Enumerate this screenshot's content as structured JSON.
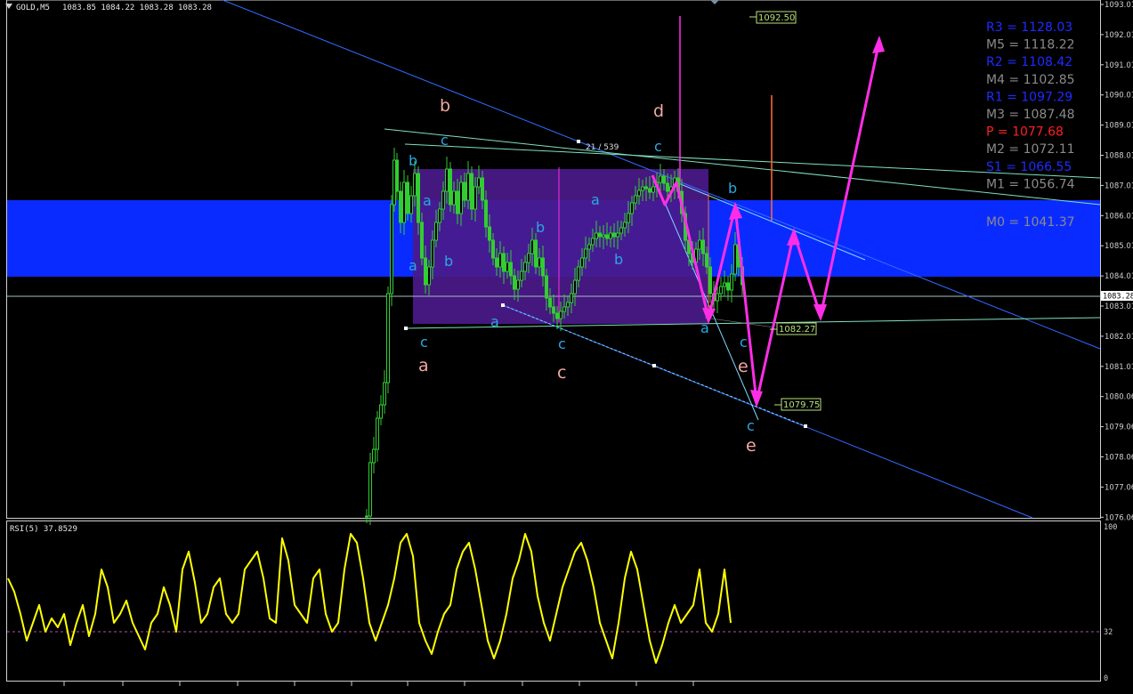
{
  "header": {
    "symbol": "GOLD,M5",
    "ohlc": "1083.85 1084.22 1083.28 1083.28"
  },
  "price_chart": {
    "current_price_label": "1083.28",
    "price_axis_labels": [
      "1093.01",
      "1092.01",
      "1091.01",
      "1090.01",
      "1089.01",
      "1088.01",
      "1087.01",
      "1086.01",
      "1085.01",
      "1084.01",
      "1083.01",
      "1082.01",
      "1081.01",
      "1080.06",
      "1079.06",
      "1078.06",
      "1077.06",
      "1076.06"
    ],
    "pivots": [
      {
        "label": "R3",
        "value": "1128.03",
        "color": "#1e2cff"
      },
      {
        "label": "M5",
        "value": "1118.22",
        "color": "#8a8a8a"
      },
      {
        "label": "R2",
        "value": "1108.42",
        "color": "#1e2cff"
      },
      {
        "label": "M4",
        "value": "1102.85",
        "color": "#8a8a8a"
      },
      {
        "label": "R1",
        "value": "1097.29",
        "color": "#1e2cff"
      },
      {
        "label": "M3",
        "value": "1087.48",
        "color": "#8a8a8a"
      },
      {
        "label": "P ",
        "value": "1077.68",
        "color": "#ff2020"
      },
      {
        "label": "M2",
        "value": "1072.11",
        "color": "#8a8a8a"
      },
      {
        "label": "S1",
        "value": "1066.55",
        "color": "#1e2cff"
      },
      {
        "label": "M1",
        "value": "1056.74",
        "color": "#8a8a8a"
      },
      {
        "label": "M0",
        "value": "1041.37",
        "color": "#8a8a8a"
      }
    ],
    "price_tags": [
      "1092.50",
      "1082.27",
      "1079.75"
    ],
    "trendline_label": "21 / 539",
    "wave_labels": [
      {
        "t": "b",
        "c": "#f0a8a0"
      },
      {
        "t": "d",
        "c": "#f0a8a0"
      },
      {
        "t": "c",
        "c": "#29a8e0"
      },
      {
        "t": "c",
        "c": "#29a8e0"
      },
      {
        "t": "b",
        "c": "#29a8e0"
      },
      {
        "t": "a",
        "c": "#29a8e0"
      },
      {
        "t": "a",
        "c": "#29a8e0"
      },
      {
        "t": "b",
        "c": "#29a8e0"
      },
      {
        "t": "b",
        "c": "#29a8e0"
      },
      {
        "t": "a",
        "c": "#29a8e0"
      },
      {
        "t": "b",
        "c": "#29a8e0"
      },
      {
        "t": "b",
        "c": "#29a8e0"
      },
      {
        "t": "a",
        "c": "#29a8e0"
      },
      {
        "t": "c",
        "c": "#29a8e0"
      },
      {
        "t": "c",
        "c": "#29a8e0"
      },
      {
        "t": "a",
        "c": "#29a8e0"
      },
      {
        "t": "c",
        "c": "#29a8e0"
      },
      {
        "t": "a",
        "c": "#f0a8a0"
      },
      {
        "t": "c",
        "c": "#f0a8a0"
      },
      {
        "t": "e",
        "c": "#f0a8a0"
      },
      {
        "t": "c",
        "c": "#29a8e0"
      },
      {
        "t": "e",
        "c": "#f0a8a0"
      }
    ]
  },
  "rsi": {
    "title": "RSI(5) 37.8529",
    "levels": [
      "100",
      "32",
      "0"
    ]
  },
  "colors": {
    "candles": "#32cd32",
    "rsi_line": "#ffff00",
    "forecast": "#ff2ee6",
    "zone": "#0a2bff",
    "box": "#4b1a8a"
  }
}
